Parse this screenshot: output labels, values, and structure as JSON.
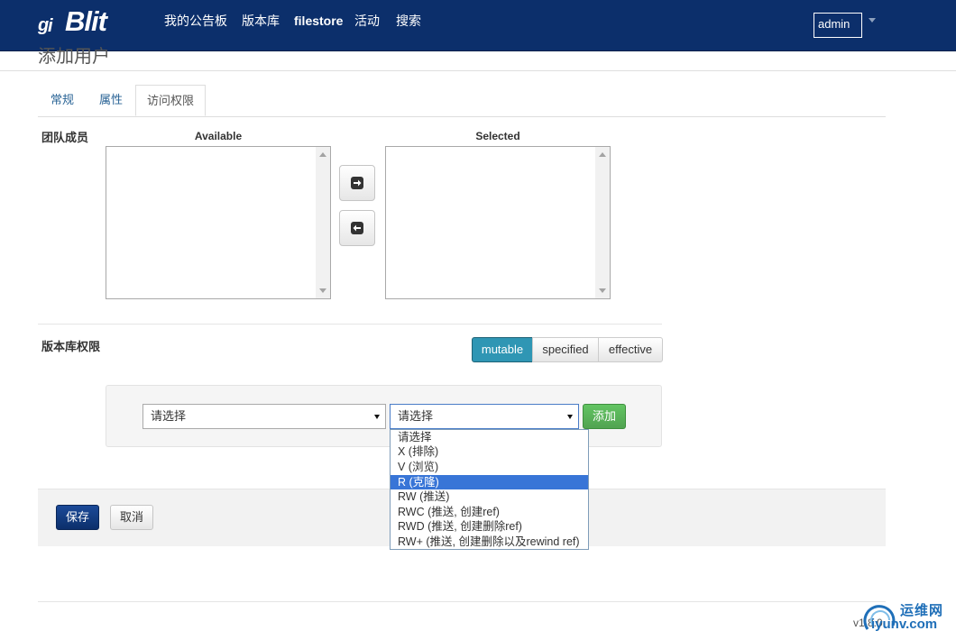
{
  "colors": {
    "navbar": "#0c2f6b",
    "tab_link": "#2a6496",
    "info_active": "#2f96b4",
    "success": "#51a351",
    "primary": "#0c2f6b",
    "highlight": "#3875d7"
  },
  "brand": {
    "name": "Blit",
    "icon": "git-icon"
  },
  "nav": {
    "items": [
      "我的公告板",
      "版本库",
      "filestore",
      "活动",
      "搜索"
    ]
  },
  "user": {
    "avatar_alt": "admin"
  },
  "page": {
    "title": "添加用户"
  },
  "tabs": [
    {
      "label": "常规"
    },
    {
      "label": "属性"
    },
    {
      "label": "访问权限",
      "active": true
    }
  ],
  "team": {
    "label": "团队成员",
    "available_header": "Available",
    "selected_header": "Selected"
  },
  "repo_perms": {
    "label": "版本库权限",
    "view_modes": [
      "mutable",
      "specified",
      "effective"
    ],
    "active_mode": "mutable",
    "repo_select_value": "请选择",
    "perm_select_value": "请选择",
    "add_label": "添加",
    "perm_options": [
      "请选择",
      "X (排除)",
      "V (浏览)",
      "R (克隆)",
      "RW (推送)",
      "RWC (推送, 创建ref)",
      "RWD (推送, 创建删除ref)",
      "RW+ (推送, 创建删除以及rewind ref)"
    ],
    "highlighted_option": "R (克隆)"
  },
  "actions": {
    "save": "保存",
    "cancel": "取消"
  },
  "footer": {
    "version": "v1.8.0"
  },
  "watermark": {
    "cn": "运维网",
    "en": "iyunv.com"
  }
}
